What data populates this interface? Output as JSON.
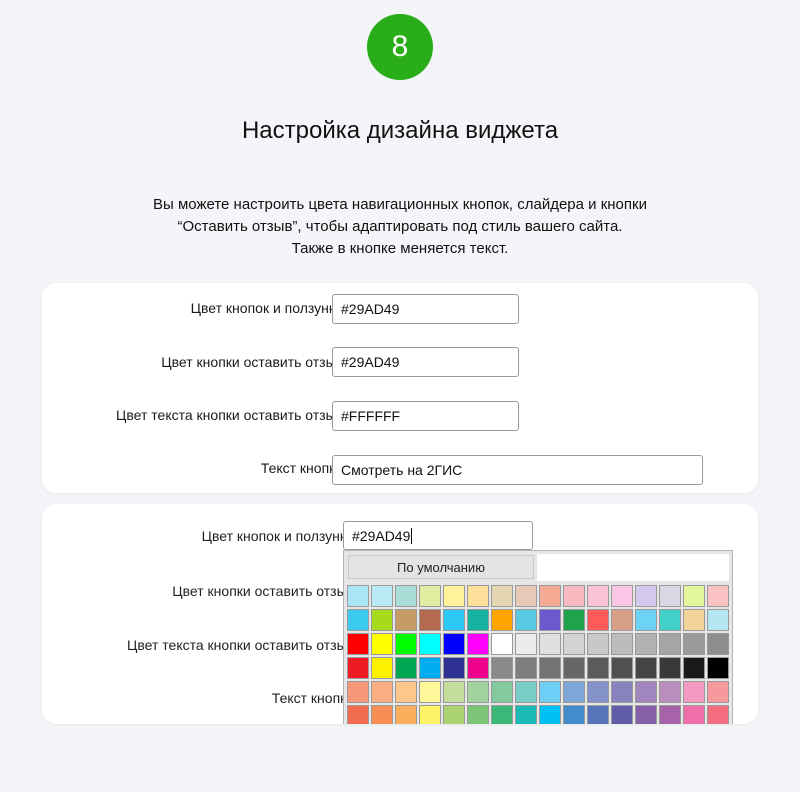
{
  "step": {
    "number": "8",
    "color": "#29AD19"
  },
  "title": "Настройка дизайна виджета",
  "description": [
    "Вы можете настроить цвета навигационных кнопок, слайдера и кнопки",
    "“Оставить отзыв”, чтобы адаптировать под стиль вашего сайта.",
    "Также в кнопке меняется текст."
  ],
  "form": {
    "fields": [
      {
        "label": "Цвет кнопок и ползунка:",
        "value": "#29AD49"
      },
      {
        "label": "Цвет кнопки оставить отзыв:",
        "value": "#29AD49"
      },
      {
        "label": "Цвет текста кнопки оставить отзыв:",
        "value": "#FFFFFF"
      },
      {
        "label": "Текст кнопки:",
        "value": "Смотреть на 2ГИС"
      }
    ]
  },
  "form_active": {
    "fields": [
      {
        "label": "Цвет кнопок и ползунка:",
        "value": "#29AD49"
      },
      {
        "label": "Цвет кнопки оставить отзыв:"
      },
      {
        "label": "Цвет текста кнопки оставить отзыв:"
      },
      {
        "label": "Текст кнопки:"
      }
    ],
    "picker": {
      "default_label": "По умолчанию",
      "rows": [
        [
          "#a9e4f7",
          "#b9eaf5",
          "#a8ddd8",
          "#dfeea0",
          "#fff29a",
          "#fde09a",
          "#e4d6b0",
          "#e8c9b8",
          "#f5aa96",
          "#f8b9c0",
          "#fbc3d4",
          "#fac6e6",
          "#d5c8ee",
          "#d8d8e4",
          "#e3f59d",
          "#f9c1c1"
        ],
        [
          "#3ccbf0",
          "#a6da1c",
          "#c79b66",
          "#b46a4e",
          "#2bc8f4",
          "#17b3a2",
          "#ffa500",
          "#58c9e0",
          "#6a5acd",
          "#1fa34a",
          "#ff5a5a",
          "#d9a088",
          "#6dd3f5",
          "#42d1c8",
          "#f2d49a",
          "#b3e6f0"
        ],
        [
          "#ff0000",
          "#ffff00",
          "#00ff00",
          "#00ffff",
          "#0000ff",
          "#ff00ff",
          "#ffffff",
          "#ebebeb",
          "#dfdfdf",
          "#d3d3d3",
          "#c8c8c8",
          "#bcbcbc",
          "#b1b1b1",
          "#a5a5a5",
          "#9a9a9a",
          "#8e8e8e"
        ],
        [
          "#ed1c24",
          "#fff200",
          "#00a651",
          "#00aeef",
          "#2e3192",
          "#ec008c",
          "#8a8a8a",
          "#7e7e7e",
          "#737373",
          "#676767",
          "#5c5c5c",
          "#505050",
          "#454545",
          "#393939",
          "#1a1a1a",
          "#000000"
        ],
        [
          "#f7977a",
          "#f9ad81",
          "#fdc68a",
          "#fff79a",
          "#c4df9b",
          "#a2d39c",
          "#82ca9d",
          "#7bcdc8",
          "#6ecff6",
          "#7ea7d8",
          "#8493ca",
          "#8882be",
          "#a187be",
          "#bc8dbf",
          "#f49ac2",
          "#f6989d"
        ],
        [
          "#f26c4f",
          "#f68e56",
          "#fbaf5d",
          "#fff467",
          "#acd372",
          "#7cc576",
          "#3bb878",
          "#1abbb4",
          "#00bff3",
          "#438ccb",
          "#5574b9",
          "#605ca8",
          "#855fa8",
          "#a763a8",
          "#f06ea9",
          "#f26d7d"
        ]
      ]
    }
  }
}
